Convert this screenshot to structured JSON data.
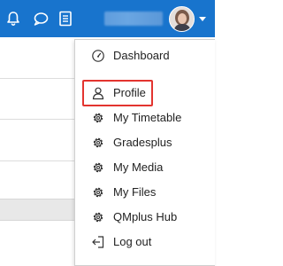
{
  "navbar": {
    "bg_color": "#1874cd",
    "icons": [
      "bell-icon",
      "chat-bubble-icon",
      "grades-report-icon"
    ],
    "user_name": ""
  },
  "user_menu": {
    "items": [
      {
        "label": "Dashboard",
        "icon": "gauge-icon"
      },
      {
        "label": "Profile",
        "icon": "user-icon",
        "highlighted": true
      },
      {
        "label": "My Timetable",
        "icon": "gear-icon"
      },
      {
        "label": "Gradesplus",
        "icon": "gear-icon"
      },
      {
        "label": "My Media",
        "icon": "gear-icon"
      },
      {
        "label": "My Files",
        "icon": "gear-icon"
      },
      {
        "label": "QMplus Hub",
        "icon": "gear-icon"
      },
      {
        "label": "Log out",
        "icon": "logout-icon"
      }
    ],
    "highlight_color": "#e3342f"
  }
}
